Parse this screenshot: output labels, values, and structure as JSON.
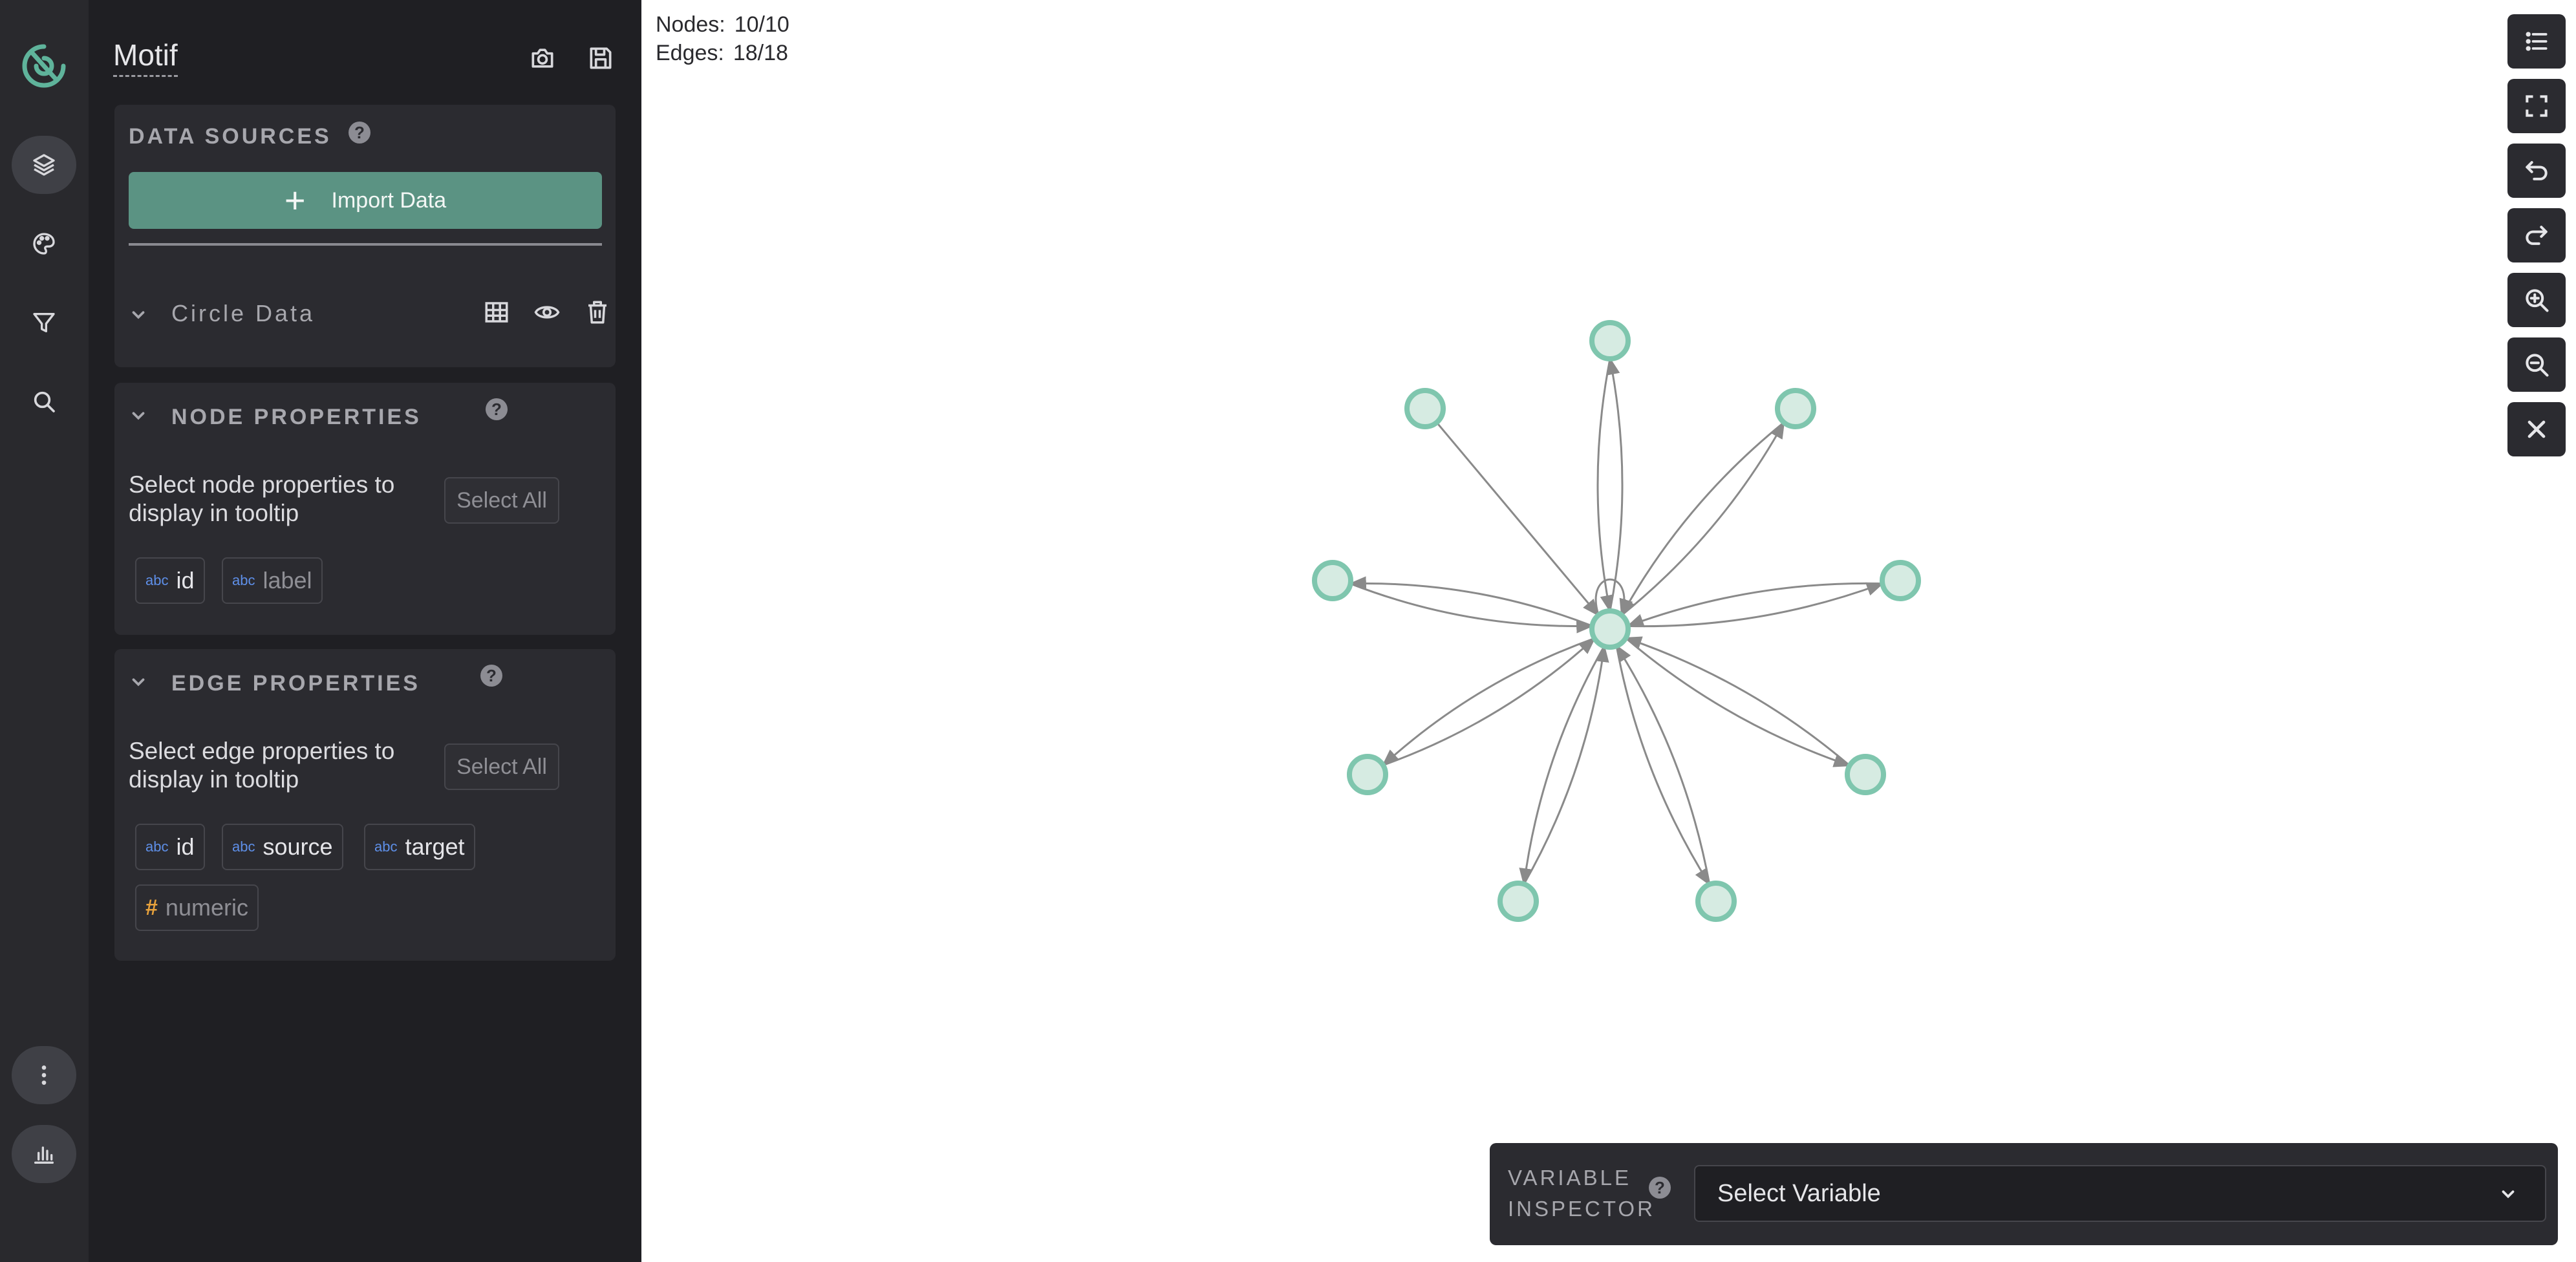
{
  "app": {
    "title": "Motif"
  },
  "rail": {
    "items": [
      {
        "icon": "layers-icon",
        "active": true
      },
      {
        "icon": "palette-icon",
        "active": false
      },
      {
        "icon": "filter-icon",
        "active": false
      },
      {
        "icon": "search-icon",
        "active": false
      }
    ],
    "bottom": [
      {
        "icon": "more-vertical-icon"
      },
      {
        "icon": "bar-chart-icon"
      }
    ]
  },
  "data_sources": {
    "title": "Data Sources",
    "import_label": "Import Data",
    "datasets": [
      {
        "name": "Circle Data"
      }
    ]
  },
  "node_properties": {
    "title": "Node Properties",
    "description": "Select node properties to display in tooltip",
    "select_all": "Select All",
    "tags": [
      {
        "type": "abc",
        "label": "id",
        "selected": true
      },
      {
        "type": "abc",
        "label": "label",
        "selected": false
      }
    ]
  },
  "edge_properties": {
    "title": "Edge Properties",
    "description": "Select edge properties to display in tooltip",
    "select_all": "Select All",
    "tags": [
      {
        "type": "abc",
        "label": "id",
        "selected": true
      },
      {
        "type": "abc",
        "label": "source",
        "selected": true
      },
      {
        "type": "abc",
        "label": "target",
        "selected": true
      },
      {
        "type": "#",
        "label": "numeric",
        "selected": false
      }
    ]
  },
  "graph": {
    "nodes_label": "Nodes:",
    "nodes_value": "10/10",
    "edges_label": "Edges:",
    "edges_value": "18/18",
    "node_color": "#7fc6ae",
    "node_fill": "#d6ebe2",
    "edge_color": "#8a8a8a"
  },
  "toolbar": {
    "buttons": [
      "list-icon",
      "fullscreen-icon",
      "undo-icon",
      "redo-icon",
      "zoom-in-icon",
      "zoom-out-icon",
      "close-icon"
    ]
  },
  "variable_inspector": {
    "label_line1": "VARIABLE",
    "label_line2": "INSPECTOR",
    "placeholder": "Select Variable"
  },
  "colors": {
    "accent": "#5b9383",
    "panel_bg": "#1f1f23",
    "card_bg": "#2b2b30",
    "rail_bg": "#29292d"
  }
}
